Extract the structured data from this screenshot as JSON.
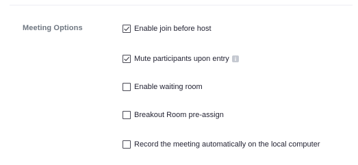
{
  "meeting_options": {
    "section_label": "Meeting Options",
    "items": [
      {
        "label": "Enable join before host",
        "checked": true,
        "icon": "checkbox-icon"
      },
      {
        "label": "Mute participants upon entry",
        "checked": true,
        "icon": "checkbox-icon",
        "trailing_icon": "info-icon"
      },
      {
        "label": "Enable waiting room",
        "checked": false,
        "icon": "checkbox-icon"
      },
      {
        "label": "Breakout Room pre-assign",
        "checked": false,
        "icon": "checkbox-icon"
      },
      {
        "label": "Record the meeting automatically on the local computer",
        "checked": false,
        "icon": "checkbox-icon"
      }
    ]
  },
  "colors": {
    "label_gray": "#6e7680",
    "text": "#232333",
    "checkbox_border": "#4a4a55",
    "info_icon": "#c5c9d1",
    "divider": "#ededf4"
  }
}
